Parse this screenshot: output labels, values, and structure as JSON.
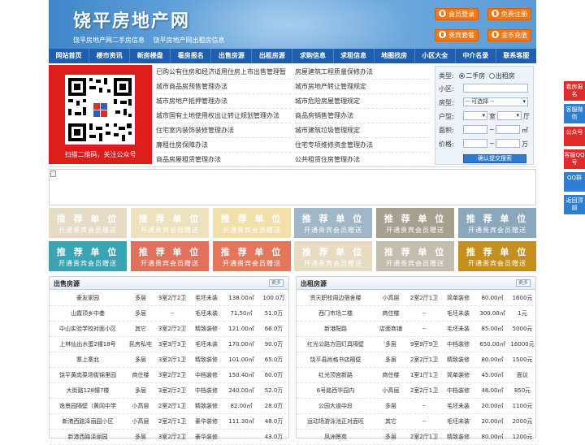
{
  "header": {
    "title": "饶平房地产网",
    "subtitle_links": [
      "饶平房地产网二手房信息",
      "饶平房地产网出租房信息"
    ],
    "buttons": {
      "member_login": "会员登录",
      "free_register": "免费注册",
      "vip_package": "贵宾套餐",
      "gold_recharge": "金币充值"
    }
  },
  "nav": {
    "items": [
      "网站首页",
      "楼市资讯",
      "新房楼盘",
      "看房报名",
      "出售房源",
      "出租房源",
      "求购信息",
      "求租信息",
      "地图找房",
      "小区大全",
      "中介名录",
      "联系客服"
    ]
  },
  "qr": {
    "caption": "扫描二维码，关注公众号"
  },
  "links": {
    "col1": [
      "已购公有住房和经济适用住房上市出售管理暂",
      "城市商品房预售管理办法",
      "城市房地产抵押管理办法",
      "城市国有土地使用权出让转让规划管理办法",
      "住宅室内装饰装修管理办法",
      "廉租住房保障办法",
      "商品房屋租赁管理办法"
    ],
    "col2": [
      "房屋建筑工程质量保修办法",
      "城市房地产转让管理规定",
      "城市危险房屋管理规定",
      "商品房销售管理办法",
      "城市建筑垃圾管理规定",
      "住宅专项维修资金管理办法",
      "公共租赁住房管理办法"
    ]
  },
  "search": {
    "type_label": "类型:",
    "type_options": [
      "二手房",
      "出租房"
    ],
    "community_label": "小区:",
    "room_type_label": "房型:",
    "room_type_value": "-- 可选择 --",
    "layout_label": "户型:",
    "room_unit": "室",
    "hall_unit": "厅",
    "area_label": "面积:",
    "area_unit": "㎡",
    "price_label": "价格:",
    "price_unit": "万",
    "range_sep": "~",
    "submit_label": "确认提交搜索"
  },
  "ads": {
    "line1": "推 荐 单 位",
    "line2": "开通贵宾会员赠送",
    "colors": [
      "#e6dcc6",
      "#eee2be",
      "#f2dfaa",
      "#9fb7c6",
      "#a6a08f",
      "#8aa7bc",
      "#3aa4b3",
      "#e0715a",
      "#e4775b",
      "#e7dcc1",
      "#c3bdae",
      "#c48f1f"
    ]
  },
  "sale_list": {
    "title": "出售房源",
    "more": "更多",
    "rows": [
      [
        "豪友家园",
        "多层",
        "3室2厅2卫",
        "毛坯未装",
        "138.00㎡",
        "100.0万"
      ],
      [
        "山霞顶乡中巷",
        "多层",
        "--",
        "毛坯未装",
        "71.50㎡",
        "51.0万"
      ],
      [
        "中山实验学校对面小区",
        "其它",
        "3室2厅2卫",
        "精致装修",
        "121.00㎡",
        "66.0万"
      ],
      [
        "上林仙出水蛋2幢18号",
        "民房私宅",
        "3室3厅3卫",
        "毛坯未装",
        "170.00㎡",
        "90.0万"
      ],
      [
        "寨上寨北",
        "多层",
        "3室2厅1卫",
        "精致装修",
        "101.00㎡",
        "65.0万"
      ],
      [
        "饶平黄岗菜场街锦里园",
        "商住楼",
        "3室2厅2卫",
        "中档装修",
        "150.40㎡",
        "60.0万"
      ],
      [
        "大街路128幢7楼",
        "多层",
        "3室2厅2卫",
        "中档装修",
        "240.00㎡",
        "52.0万"
      ],
      [
        "逸景园隔壁（黄冈中学",
        "小高层",
        "2室2厅1卫",
        "精致装修",
        "82.00㎡",
        "28.0万"
      ],
      [
        "新港西路泽丽园小区",
        "小高层",
        "2室2厅1卫",
        "豪华装修",
        "111.30㎡",
        "48.0万"
      ],
      [
        "新港西路泽丽园",
        "多层",
        "3室2厅2卫",
        "豪华装修",
        "",
        "43.0万"
      ]
    ]
  },
  "rent_list": {
    "title": "出租房源",
    "more": "更多",
    "rows": [
      [
        "资天职校周边宿舍楼",
        "小高层",
        "2室2厅1卫",
        "简单装修",
        "80.00㎡",
        "1600元"
      ],
      [
        "西门市场二楼",
        "商住楼",
        "--",
        "毛坯未装",
        "300.00㎡",
        "1元"
      ],
      [
        "新港配路",
        "店面商铺",
        "--",
        "毛坯未装",
        "85.00㎡",
        "5000元"
      ],
      [
        "红光公路方园灯具隔壁",
        "多层",
        "9室9厅9卫",
        "中档装修",
        "650.00㎡",
        "16000元"
      ],
      [
        "饶平县尚格书店隔壁",
        "多层",
        "2室2厅1卫",
        "精致装修",
        "80.00㎡",
        "1500元"
      ],
      [
        "红光顶宫新路",
        "商住楼",
        "1室1厅1卫",
        "简单装修",
        "45.00㎡",
        "面议"
      ],
      [
        "6号路西华园内",
        "小高层",
        "2室2厅1卫",
        "中档装修",
        "46.00㎡",
        "850元"
      ],
      [
        "公园大道中段",
        "多层",
        "--",
        "毛坯未装",
        "20.00㎡",
        "1100元"
      ],
      [
        "运动场游泳池正对面旺",
        "其它",
        "--",
        "毛坯未装",
        "20.00㎡",
        "2000元"
      ],
      [
        "凤洲景苑",
        "多层",
        "2室2厅1卫",
        "精致装修",
        "80.00㎡",
        "1200元"
      ]
    ]
  },
  "side": {
    "items": [
      "看房报名",
      "客服微信",
      "公众号",
      "客服QQ号",
      "QQ群",
      "返回顶部"
    ]
  }
}
